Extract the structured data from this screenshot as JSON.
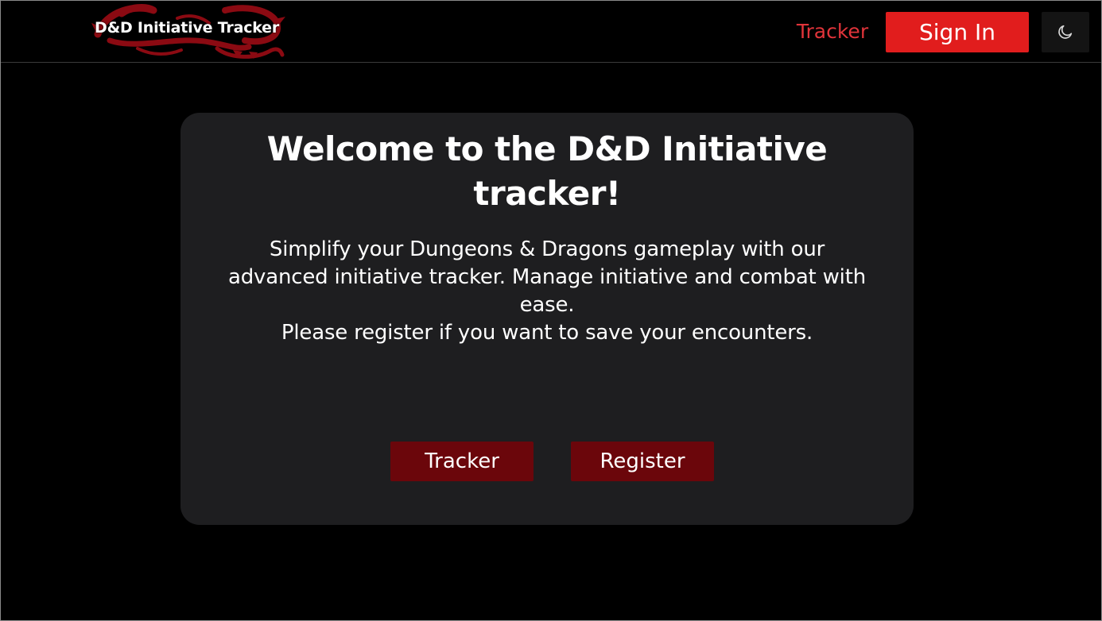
{
  "navbar": {
    "logo_text": "D&D Initiative Tracker",
    "tracker_link": "Tracker",
    "signin_label": "Sign In",
    "theme_icon": "moon-icon"
  },
  "card": {
    "title": "Welcome to the D&D Initiative tracker!",
    "description_line1": "Simplify your Dungeons & Dragons gameplay with our advanced initiative tracker. Manage initiative and combat with ease.",
    "description_line2": "Please register if you want to save your encounters.",
    "tracker_button": "Tracker",
    "register_button": "Register"
  },
  "colors": {
    "background": "#000000",
    "card_background": "#1e1e20",
    "nav_link": "#e0343a",
    "signin_button": "#e11d1d",
    "card_button": "#6b060b",
    "logo_dragon": "#8b0a12"
  }
}
